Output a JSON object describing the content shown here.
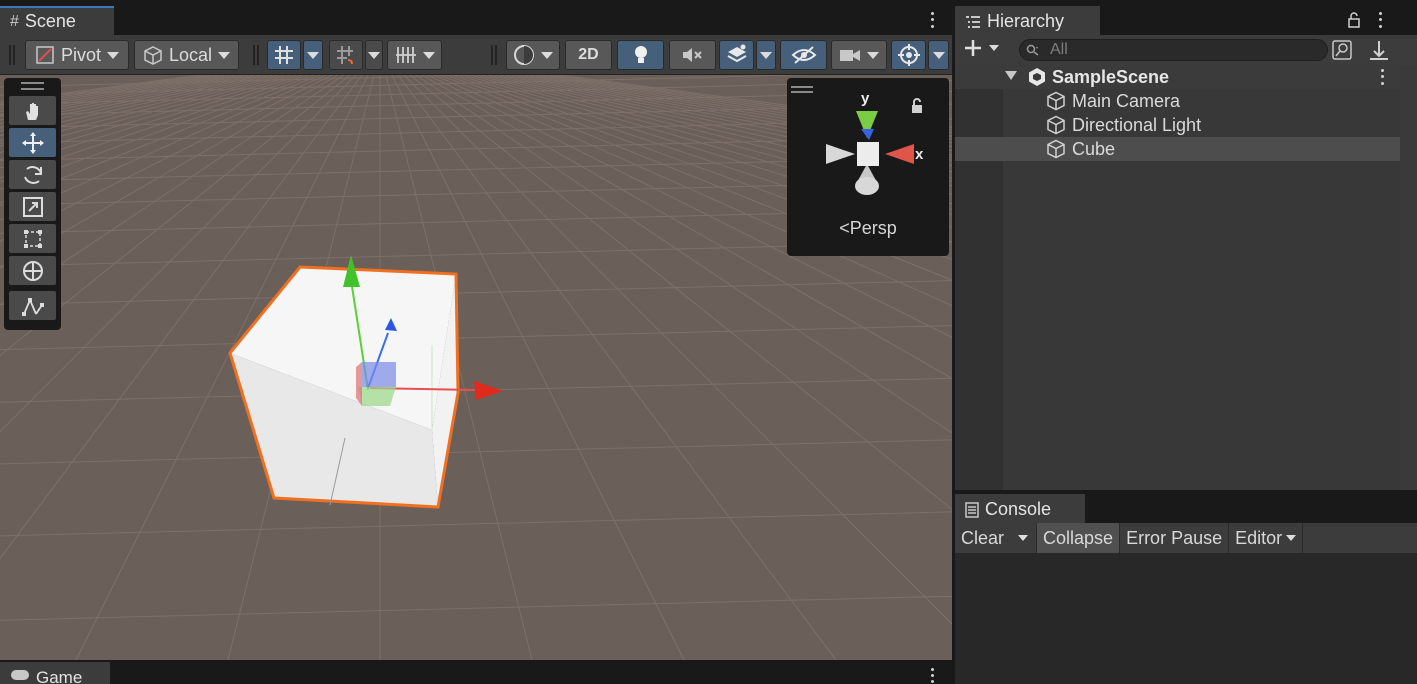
{
  "scene": {
    "tab_label": "Scene",
    "tab_icon": "#",
    "toolbar": {
      "pivot_label": "Pivot",
      "local_label": "Local",
      "mode_2d_label": "2D"
    },
    "gizmo": {
      "y_label": "y",
      "x_label": "x",
      "projection_label": "Persp"
    }
  },
  "game": {
    "tab_label": "Game"
  },
  "hierarchy": {
    "tab_label": "Hierarchy",
    "search_placeholder": "All",
    "scene_name": "SampleScene",
    "items": [
      {
        "label": "Main Camera",
        "selected": false
      },
      {
        "label": "Directional Light",
        "selected": false
      },
      {
        "label": "Cube",
        "selected": true
      }
    ]
  },
  "console": {
    "tab_label": "Console",
    "clear_label": "Clear",
    "collapse_label": "Collapse",
    "error_pause_label": "Error Pause",
    "editor_label": "Editor"
  },
  "colors": {
    "accent": "#3a79bb",
    "active_button": "#46607c",
    "selection_outline": "#f07020",
    "axis_x": "#e02a1c",
    "axis_y": "#56d237",
    "axis_z": "#2c56e6",
    "ground": "#6b5f59"
  }
}
